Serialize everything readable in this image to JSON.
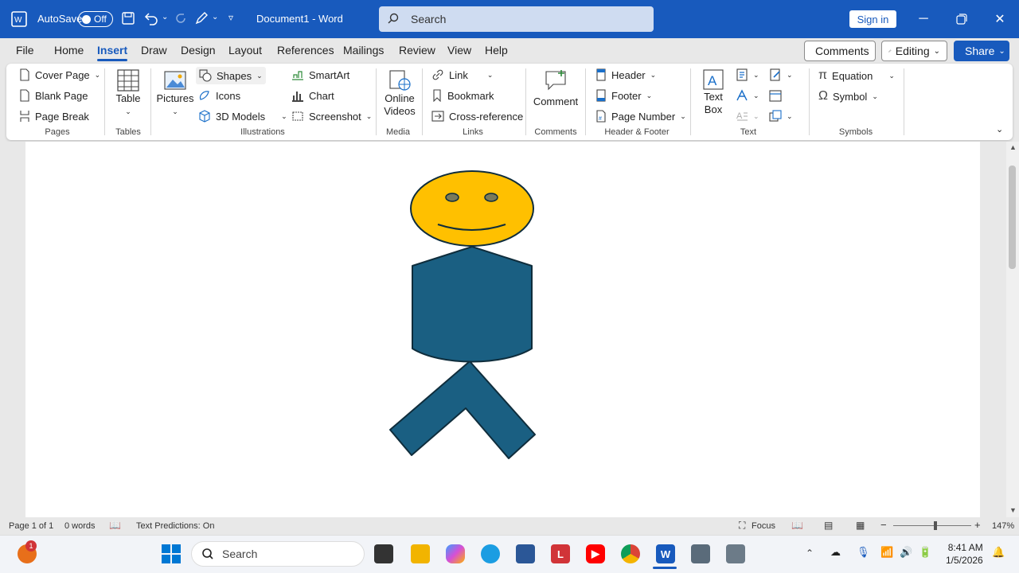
{
  "titlebar": {
    "autosave_label": "AutoSave",
    "autosave_state": "Off",
    "doc_title": "Document1  -  Word",
    "search_placeholder": "Search",
    "signin_label": "Sign in"
  },
  "tabs": [
    "File",
    "Home",
    "Insert",
    "Draw",
    "Design",
    "Layout",
    "References",
    "Mailings",
    "Review",
    "View",
    "Help"
  ],
  "active_tab": "Insert",
  "top_buttons": {
    "comments": "Comments",
    "editing": "Editing",
    "share": "Share"
  },
  "ribbon": {
    "pages": {
      "cover": "Cover Page",
      "blank": "Blank Page",
      "break": "Page Break",
      "group": "Pages"
    },
    "tables": {
      "table": "Table",
      "group": "Tables"
    },
    "illustrations": {
      "pictures": "Pictures",
      "shapes": "Shapes",
      "icons": "Icons",
      "models": "3D Models",
      "smartart": "SmartArt",
      "chart": "Chart",
      "screenshot": "Screenshot",
      "group": "Illustrations"
    },
    "media": {
      "online1": "Online",
      "online2": "Videos",
      "group": "Media"
    },
    "links": {
      "link": "Link",
      "bookmark": "Bookmark",
      "crossref": "Cross-reference",
      "group": "Links"
    },
    "comments": {
      "comment": "Comment",
      "group": "Comments"
    },
    "headerfooter": {
      "header": "Header",
      "footer": "Footer",
      "pagenumber": "Page Number",
      "group": "Header & Footer"
    },
    "text": {
      "textbox1": "Text",
      "textbox2": "Box",
      "group": "Text"
    },
    "symbols": {
      "equation": "Equation",
      "symbol": "Symbol",
      "group": "Symbols"
    }
  },
  "colors": {
    "accent": "#185abd",
    "head": "#ffc000",
    "body": "#1a5f82",
    "outline": "#0f2d3c"
  },
  "status": {
    "page": "Page 1 of 1",
    "words": "0 words",
    "predictions": "Text Predictions: On",
    "focus": "Focus",
    "zoom": "147%"
  },
  "taskbar": {
    "search": "Search",
    "time": "8:41 AM",
    "date": "1/5/2026",
    "badge": "1"
  }
}
